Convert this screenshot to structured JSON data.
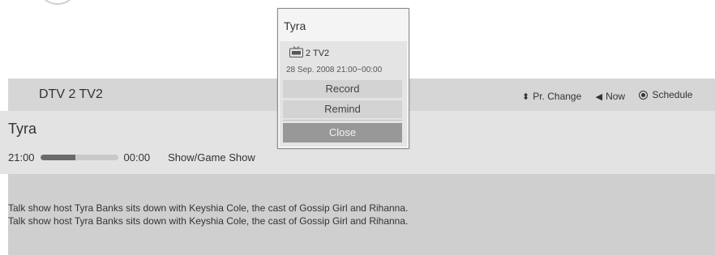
{
  "channel": {
    "name": "DTV 2  TV2"
  },
  "hints": [
    {
      "icon": "updown-arrow-icon",
      "glyph": "⬍",
      "label": "Pr. Change"
    },
    {
      "icon": "left-triangle-icon",
      "glyph": "◀",
      "label": "Now"
    },
    {
      "icon": "radio-button-icon",
      "glyph": "",
      "label": "Schedule"
    }
  ],
  "program": {
    "title": "Tyra",
    "start": "21:00",
    "end": "00:00",
    "progress": 0.45,
    "genre": "Show/Game Show",
    "description_lines": [
      "Talk show host Tyra Banks sits down with Keyshia Cole, the cast of Gossip Girl and Rihanna.",
      "Talk show host Tyra Banks sits down with Keyshia Cole, the cast of Gossip Girl and Rihanna."
    ]
  },
  "popup": {
    "title": "Tyra",
    "channel_icon": "tv-icon",
    "channel": "2 TV2",
    "datetime": "28 Sep. 2008 21:00~00:00",
    "record_label": "Record",
    "remind_label": "Remind",
    "close_label": "Close"
  }
}
